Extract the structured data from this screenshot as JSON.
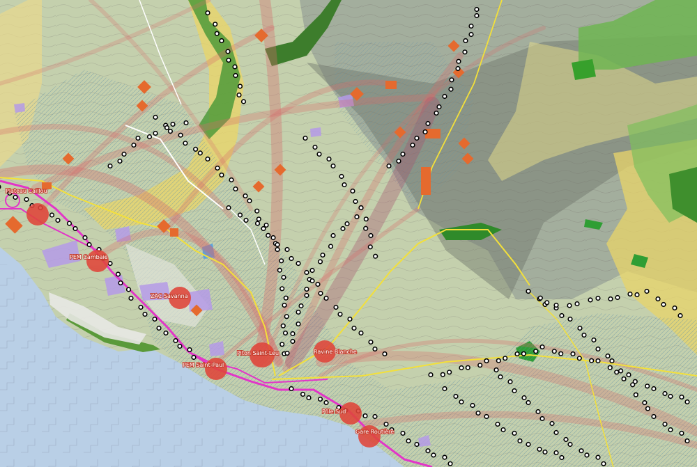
{
  "map": {
    "colors": {
      "sea": "#b9cfe6",
      "land": "#c4d0ad",
      "urban_hatch": "#5b8fa8",
      "upland": "#9ea89a",
      "shadow": "#7d8579",
      "forest": "#4f9a3a",
      "yellow_zone": "#e8d46a",
      "road_yellow": "#f3e03a",
      "road_magenta": "#e235c8",
      "flow_arc": "#d86a6a",
      "hub_red": "#e0453a",
      "zone_orange": "#e56a2e",
      "stop_ring": "#000000",
      "purple_zone": "#b59be8"
    },
    "hub_labels": [
      "Plateau Caillou",
      "PEM Cambaie",
      "ZAC Savanna",
      "PEM Saint-Paul",
      "Piton Saint-Leu",
      "Ravine Blanche",
      "Pôle Sud",
      "Gare Routière"
    ]
  }
}
